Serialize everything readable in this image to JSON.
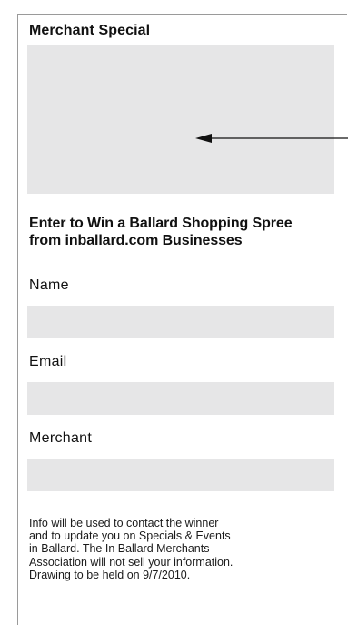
{
  "special": {
    "title": "Merchant Special"
  },
  "contest": {
    "title_lines": [
      "Enter to Win a Ballard Shopping Spree",
      "from inballard.com Businesses"
    ]
  },
  "form": {
    "fields": [
      {
        "label": "Name",
        "value": ""
      },
      {
        "label": "Email",
        "value": ""
      },
      {
        "label": "Merchant",
        "value": ""
      }
    ]
  },
  "disclaimer": {
    "lines": [
      "Info will be used to contact the winner",
      "and to update you on Specials & Events",
      "in Ballard. The In Ballard Merchants",
      "Association will not sell your information.",
      "Drawing to be held on 9/7/2010."
    ]
  },
  "colors": {
    "box_fill": "#e6e6e7",
    "border": "#9a9a9a",
    "text": "#111111"
  },
  "icons": {
    "pointer": "arrow-left-icon"
  }
}
